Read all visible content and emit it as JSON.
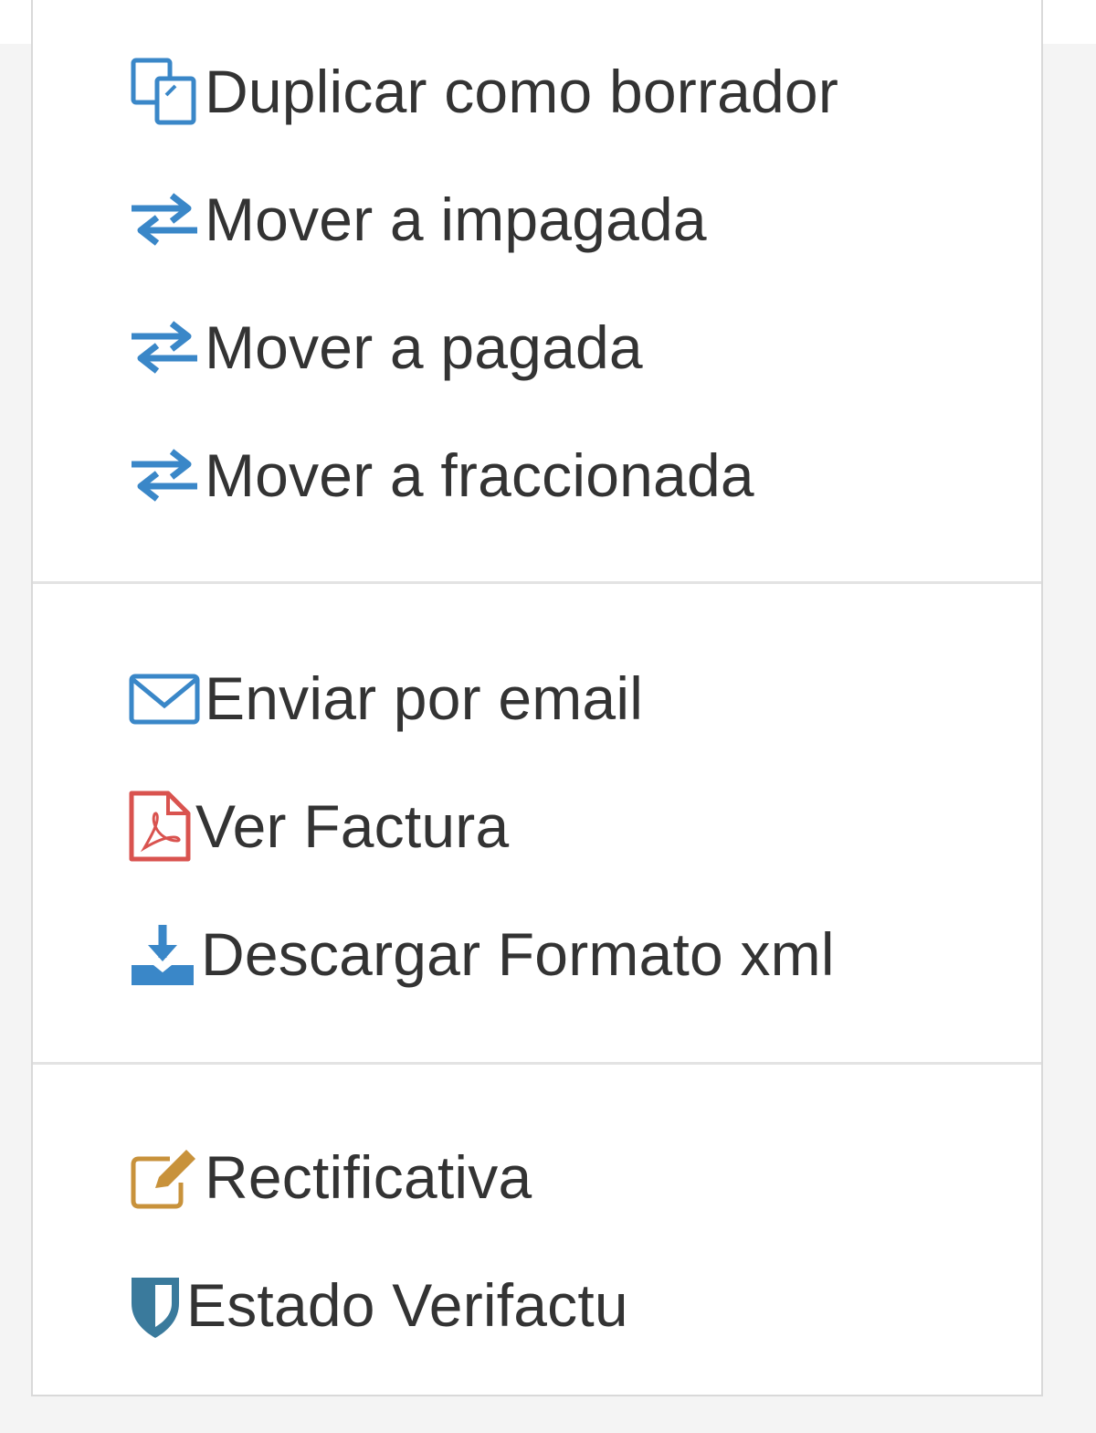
{
  "menu": {
    "group1": [
      {
        "label": "Duplicar como borrador",
        "icon": "copy-icon"
      },
      {
        "label": "Mover a impagada",
        "icon": "exchange-icon"
      },
      {
        "label": "Mover a pagada",
        "icon": "exchange-icon"
      },
      {
        "label": "Mover a fraccionada",
        "icon": "exchange-icon"
      }
    ],
    "group2": [
      {
        "label": "Enviar por email",
        "icon": "envelope-icon"
      },
      {
        "label": "Ver Factura",
        "icon": "pdf-file-icon"
      },
      {
        "label": "Descargar Formato xml",
        "icon": "download-icon"
      }
    ],
    "group3": [
      {
        "label": "Rectificativa",
        "icon": "edit-icon"
      },
      {
        "label": "Estado Verifactu",
        "icon": "shield-icon"
      }
    ]
  },
  "colors": {
    "icon_blue": "#3a87c8",
    "icon_red": "#d9534f",
    "icon_gold": "#c8923b",
    "icon_shield": "#3a7a9c",
    "text": "#333333",
    "divider": "#e3e3e3",
    "border": "#d9d9d9"
  }
}
